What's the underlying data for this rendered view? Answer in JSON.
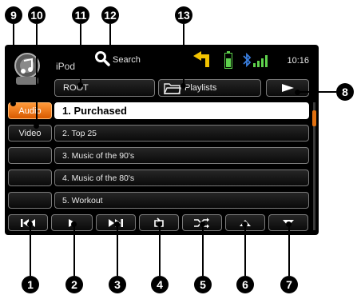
{
  "screen": {
    "app_title": "iPod",
    "search_label": "Search",
    "clock": "10:16",
    "path_root": "ROOT",
    "path_playlists": "Playlists"
  },
  "sidebar": {
    "items": [
      {
        "label": "Audio",
        "active": true
      },
      {
        "label": "Video",
        "active": false
      }
    ]
  },
  "list": {
    "items": [
      {
        "label": "1. Purchased",
        "selected": true
      },
      {
        "label": "2. Top 25",
        "selected": false
      },
      {
        "label": "3. Music of the 90's",
        "selected": false
      },
      {
        "label": "4. Music of the 80's",
        "selected": false
      },
      {
        "label": "5. Workout",
        "selected": false
      }
    ]
  },
  "controls": [
    {
      "icon": "previous-track-icon"
    },
    {
      "icon": "play-icon"
    },
    {
      "icon": "next-track-icon"
    },
    {
      "icon": "repeat-icon"
    },
    {
      "icon": "shuffle-icon"
    },
    {
      "icon": "scroll-up-icon"
    },
    {
      "icon": "scroll-down-icon"
    }
  ],
  "callouts": {
    "c1": "1",
    "c2": "2",
    "c3": "3",
    "c4": "4",
    "c5": "5",
    "c6": "6",
    "c7": "7",
    "c8": "8",
    "c9": "9",
    "c10": "10",
    "c11": "11",
    "c12": "12",
    "c13": "13"
  },
  "colors": {
    "accent": "#f07a10",
    "background": "#000000",
    "button_border": "#7a7a7a",
    "status_green": "#5ed24c",
    "bluetooth_blue": "#3a7fe0",
    "navigation_yellow": "#f2c200"
  }
}
